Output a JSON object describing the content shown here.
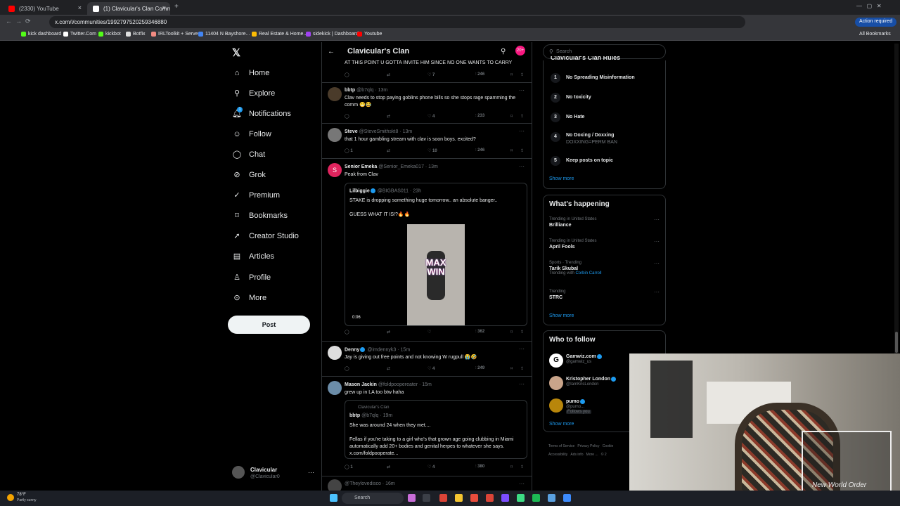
{
  "browser": {
    "tabs": [
      {
        "title": "(2330) YouTube",
        "color": "#ff0000"
      },
      {
        "title": "(1) Clavicular's Clan Communi...",
        "color": "#ffffff"
      }
    ],
    "url": "x.com/i/communities/1992797520259346880",
    "action_required": "Action required",
    "bookmarks": [
      "kick dashboard",
      "Twitter.Com",
      "kickbot",
      "Botfix",
      "IRLToolkit + Server",
      "11404 N Bayshore...",
      "Real Estate & Home...",
      "sidekick | Dashboard",
      "Youtube"
    ],
    "all_bookmarks": "All Bookmarks"
  },
  "nav": {
    "items": [
      "Home",
      "Explore",
      "Notifications",
      "Follow",
      "Chat",
      "Grok",
      "Premium",
      "Bookmarks",
      "Creator Studio",
      "Articles",
      "Profile",
      "More"
    ],
    "post_label": "Post",
    "account_name": "Clavicular",
    "account_handle": "@Clavicular0",
    "notif_badge": "1"
  },
  "header": {
    "title": "Clavicular's Clan",
    "badge": "20+"
  },
  "feed": [
    {
      "text": "AT THIS POINT U GOTTA INVITE HIM SINCE NO ONE WANTS TO CARRY",
      "likes": "7",
      "views": "246"
    },
    {
      "name": "bbtp",
      "handle": "@b7qlq · 13m",
      "text": "Clav needs to stop paying goblins phone bills so she stops rage spamming the comm 😁😂",
      "likes": "4",
      "views": "233"
    },
    {
      "name": "Steve",
      "handle": "@SteveSmithskt8 · 13m",
      "text": "that 1 hour gambling stream with clav is soon boys. excited?",
      "replies": "1",
      "likes": "10",
      "views": "246"
    },
    {
      "name": "Senior Emeka",
      "handle": "@Senior_Emeka017 · 13m",
      "text": "Peak from Clav",
      "quote_name": "Lilbiggie",
      "quote_handle": "@BIGBAS011 · 23h",
      "quote_text1": "STAKE is dropping something huge tomorrow.. an absolute banger..",
      "quote_text2": "GUESS WHAT IT IS!?🔥🔥",
      "video_time": "0:06",
      "video_overlay": "MAX WIN",
      "views": "362"
    },
    {
      "name": "Denny",
      "handle": "@imdennyk3 · 15m",
      "text": "Jay is giving out free points and not knowing W rugpull 😭🤣",
      "likes": "4",
      "views": "249"
    },
    {
      "name": "Mason Jackin",
      "handle": "@foldpoopereater · 15m",
      "text": "grew up in LA too btw haha",
      "quote_community": "Clavicular's Clan",
      "quote_name": "bbtp",
      "quote_handle": "@b7qlq · 19m",
      "quote_text1": "She was around 24 when they met....",
      "quote_text2": "Fellas if you're taking to a girl who's that grown age going clubbing in Miami automatically add 20+ bodies and genital herpes to whatever she says. x.com/foldpooperate...",
      "replies": "1",
      "likes": "4",
      "views": "380"
    },
    {
      "handle": "@Theylovedisco · 16m"
    }
  ],
  "right": {
    "search_placeholder": "Search",
    "rules_title": "Clavicular's Clan Rules",
    "rules": [
      {
        "n": "1",
        "text": "No Spreading Misinformation"
      },
      {
        "n": "2",
        "text": "No toxicity"
      },
      {
        "n": "3",
        "text": "No Hate"
      },
      {
        "n": "4",
        "text": "No Doxing / Doxxing",
        "sub": "DOXXING=PERM BAN"
      },
      {
        "n": "5",
        "text": "Keep posts on topic"
      }
    ],
    "show_more": "Show more",
    "happening_title": "What's happening",
    "trends": [
      {
        "meta": "Trending in United States",
        "name": "Brilliance"
      },
      {
        "meta": "Trending in United States",
        "name": "April Fools"
      },
      {
        "meta": "Sports · Trending",
        "name": "Tarik Skubal",
        "extra": "Trending with",
        "link": "Corbin Carroll"
      },
      {
        "meta": "Trending",
        "name": "STRC"
      }
    ],
    "follow_title": "Who to follow",
    "follow": [
      {
        "name": "Gamwiz.com",
        "handle": "@gamwiz_us"
      },
      {
        "name": "Kristopher London",
        "handle": "@IamKrisLondon"
      },
      {
        "name": "pumo",
        "handle": "@pumo...",
        "tag": "Follows you"
      }
    ],
    "footer": [
      "Terms of Service",
      "Privacy Policy",
      "Cookie",
      "Accessibility",
      "Ads info",
      "More ...",
      "© 2"
    ]
  },
  "taskbar": {
    "weather_temp": "78°F",
    "weather_desc": "Partly sunny",
    "search": "Search"
  },
  "webcam": {
    "overlay_text": "New World Order"
  }
}
